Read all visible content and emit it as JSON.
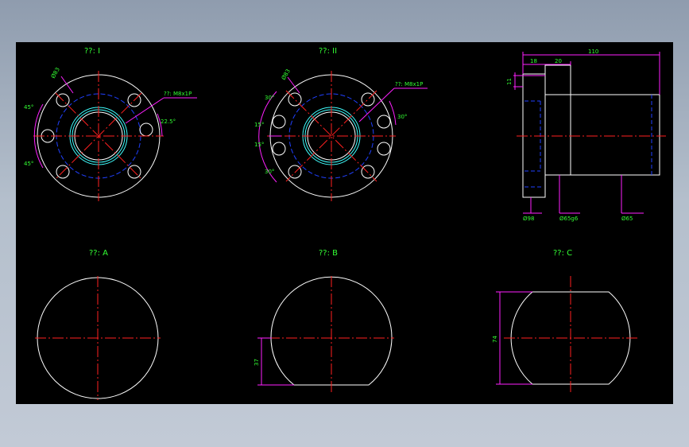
{
  "views": {
    "view_I": "??: I",
    "view_II": "??: II",
    "view_A": "??: A",
    "view_B": "??: B",
    "view_C": "??: C"
  },
  "dims_I": {
    "bolt_circle": "Ø83",
    "thread": "??: M8x1P",
    "angle_top": "45°",
    "angle_bottom": "45°",
    "angle_right": "22.5°"
  },
  "dims_II": {
    "bolt_circle": "Ø83",
    "thread": "??: M8x1P",
    "angle_1": "30°",
    "angle_2": "15°",
    "angle_3": "15°",
    "angle_4": "30°",
    "angle_right": "30°"
  },
  "dims_side": {
    "d1": "18",
    "d2": "20",
    "d3": "110",
    "d4": "11",
    "dia1": "Ø98",
    "dia2": "Ø65g6",
    "dia3": "Ø65"
  },
  "dims_bottom": {
    "b_height": "37",
    "c_height": "74"
  },
  "colors": {
    "outline": "#ffffff",
    "centerline": "#ff2020",
    "hidden": "#2040ff",
    "dimension": "#ff20ff",
    "text": "#33ff33",
    "bore": "#40ffff"
  }
}
